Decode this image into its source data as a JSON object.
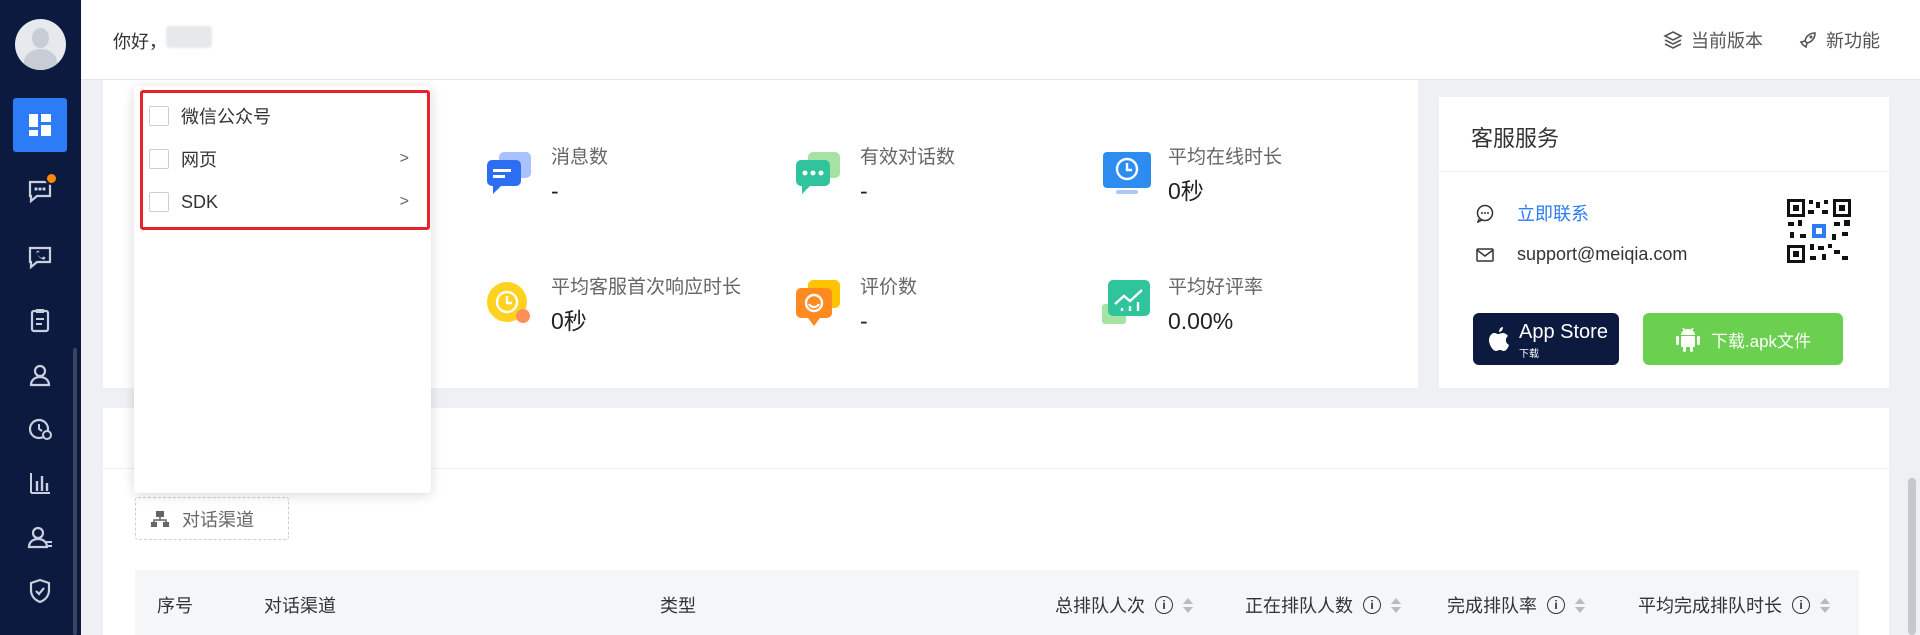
{
  "header": {
    "greeting": "你好，",
    "actions": [
      {
        "label": "当前版本",
        "icon": "layers-icon"
      },
      {
        "label": "新功能",
        "icon": "rocket-icon"
      }
    ]
  },
  "sidebar": {
    "items": [
      {
        "name": "dashboard",
        "icon": "dashboard-icon",
        "active": true
      },
      {
        "name": "chat",
        "icon": "chat-bubble-icon",
        "badge": true
      },
      {
        "name": "call",
        "icon": "phone-icon"
      },
      {
        "name": "tickets",
        "icon": "clipboard-icon"
      },
      {
        "name": "visitors",
        "icon": "user-icon"
      },
      {
        "name": "history",
        "icon": "clock-chat-icon"
      },
      {
        "name": "stats",
        "icon": "bar-chart-icon"
      },
      {
        "name": "team",
        "icon": "team-icon"
      },
      {
        "name": "security",
        "icon": "shield-icon"
      }
    ]
  },
  "stats": {
    "messages": {
      "label": "消息数",
      "value": "-"
    },
    "valid_dialogs": {
      "label": "有效对话数",
      "value": "-"
    },
    "avg_online": {
      "label": "平均在线时长",
      "value": "0秒"
    },
    "avg_first_response": {
      "label": "平均客服首次响应时长",
      "value": "0秒"
    },
    "ratings": {
      "label": "评价数",
      "value": "-"
    },
    "good_rate": {
      "label": "平均好评率",
      "value": "0.00%"
    }
  },
  "service": {
    "title": "客服服务",
    "contact_label": "立即联系",
    "email": "support@meiqia.com",
    "appstore_label": "App Store",
    "appstore_sub": "下载",
    "apk_label": "下载.apk文件"
  },
  "dropdown": {
    "items": [
      {
        "label": "微信公众号",
        "has_children": false
      },
      {
        "label": "网页",
        "has_children": true
      },
      {
        "label": "SDK",
        "has_children": true
      }
    ]
  },
  "channel_filter": {
    "label": "对话渠道"
  },
  "table": {
    "columns": [
      "序号",
      "对话渠道",
      "类型",
      "总排队人次",
      "正在排队人数",
      "完成排队率",
      "平均完成排队时长"
    ]
  },
  "colors": {
    "sidebar_bg": "#0d1a40",
    "accent": "#2b7cf6",
    "highlight": "#e8212b",
    "apk_green": "#6bcf4f"
  }
}
